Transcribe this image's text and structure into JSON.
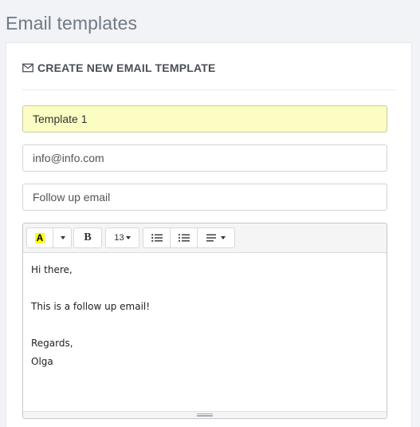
{
  "page": {
    "title": "Email templates"
  },
  "panel": {
    "heading": "CREATE NEW EMAIL TEMPLATE",
    "heading_icon": "envelope-icon"
  },
  "form": {
    "template_name": "Template 1",
    "from_email": "info@info.com",
    "subject": "Follow up email"
  },
  "editor": {
    "toolbar": {
      "color_label": "A",
      "color_highlight": "#ffff00",
      "bold_label": "B",
      "font_size": "13",
      "icons": [
        "text-color-icon",
        "bold-icon",
        "bullet-list-icon",
        "numbered-list-icon",
        "align-icon"
      ]
    },
    "lines": [
      "Hi there,",
      "",
      "This is a follow up email!",
      "",
      "Regards,",
      "Olga"
    ]
  }
}
